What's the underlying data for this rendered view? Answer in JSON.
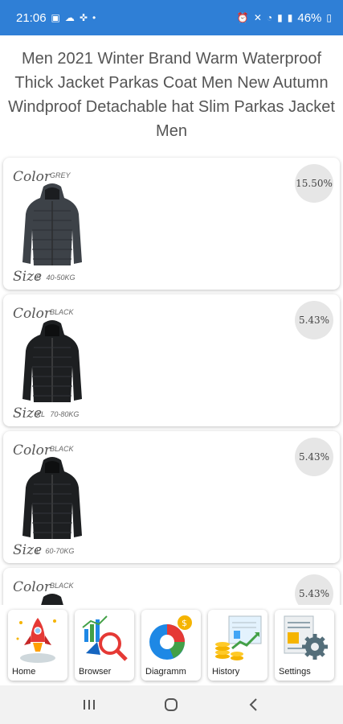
{
  "status": {
    "time": "21:06",
    "battery": "46%",
    "bg_color": "#2f7fd6"
  },
  "product": {
    "title": "Men 2021 Winter Brand Warm Waterproof Thick Jacket Parkas Coat Men New Autumn Windproof Detachable hat Slim Parkas Jacket Men"
  },
  "labels": {
    "color": "Color",
    "size": "Size"
  },
  "variants": [
    {
      "color": "GREY",
      "size": "S 40-50KG",
      "percent": "15.50%",
      "jacket_color": "#3d4248"
    },
    {
      "color": "BLACK",
      "size": "XL 70-80KG",
      "percent": "5.43%",
      "jacket_color": "#1d1f21"
    },
    {
      "color": "BLACK",
      "size": "L 60-70KG",
      "percent": "5.43%",
      "jacket_color": "#1d1f21"
    },
    {
      "color": "BLACK",
      "size": "",
      "percent": "5.43%",
      "jacket_color": "#1d1f21"
    }
  ],
  "nav": [
    {
      "label": "Home",
      "icon": "rocket-icon"
    },
    {
      "label": "Browser",
      "icon": "search-chart-icon"
    },
    {
      "label": "Diagramm",
      "icon": "pie-chart-icon"
    },
    {
      "label": "History",
      "icon": "growth-chart-icon"
    },
    {
      "label": "Settings",
      "icon": "gear-document-icon"
    }
  ]
}
